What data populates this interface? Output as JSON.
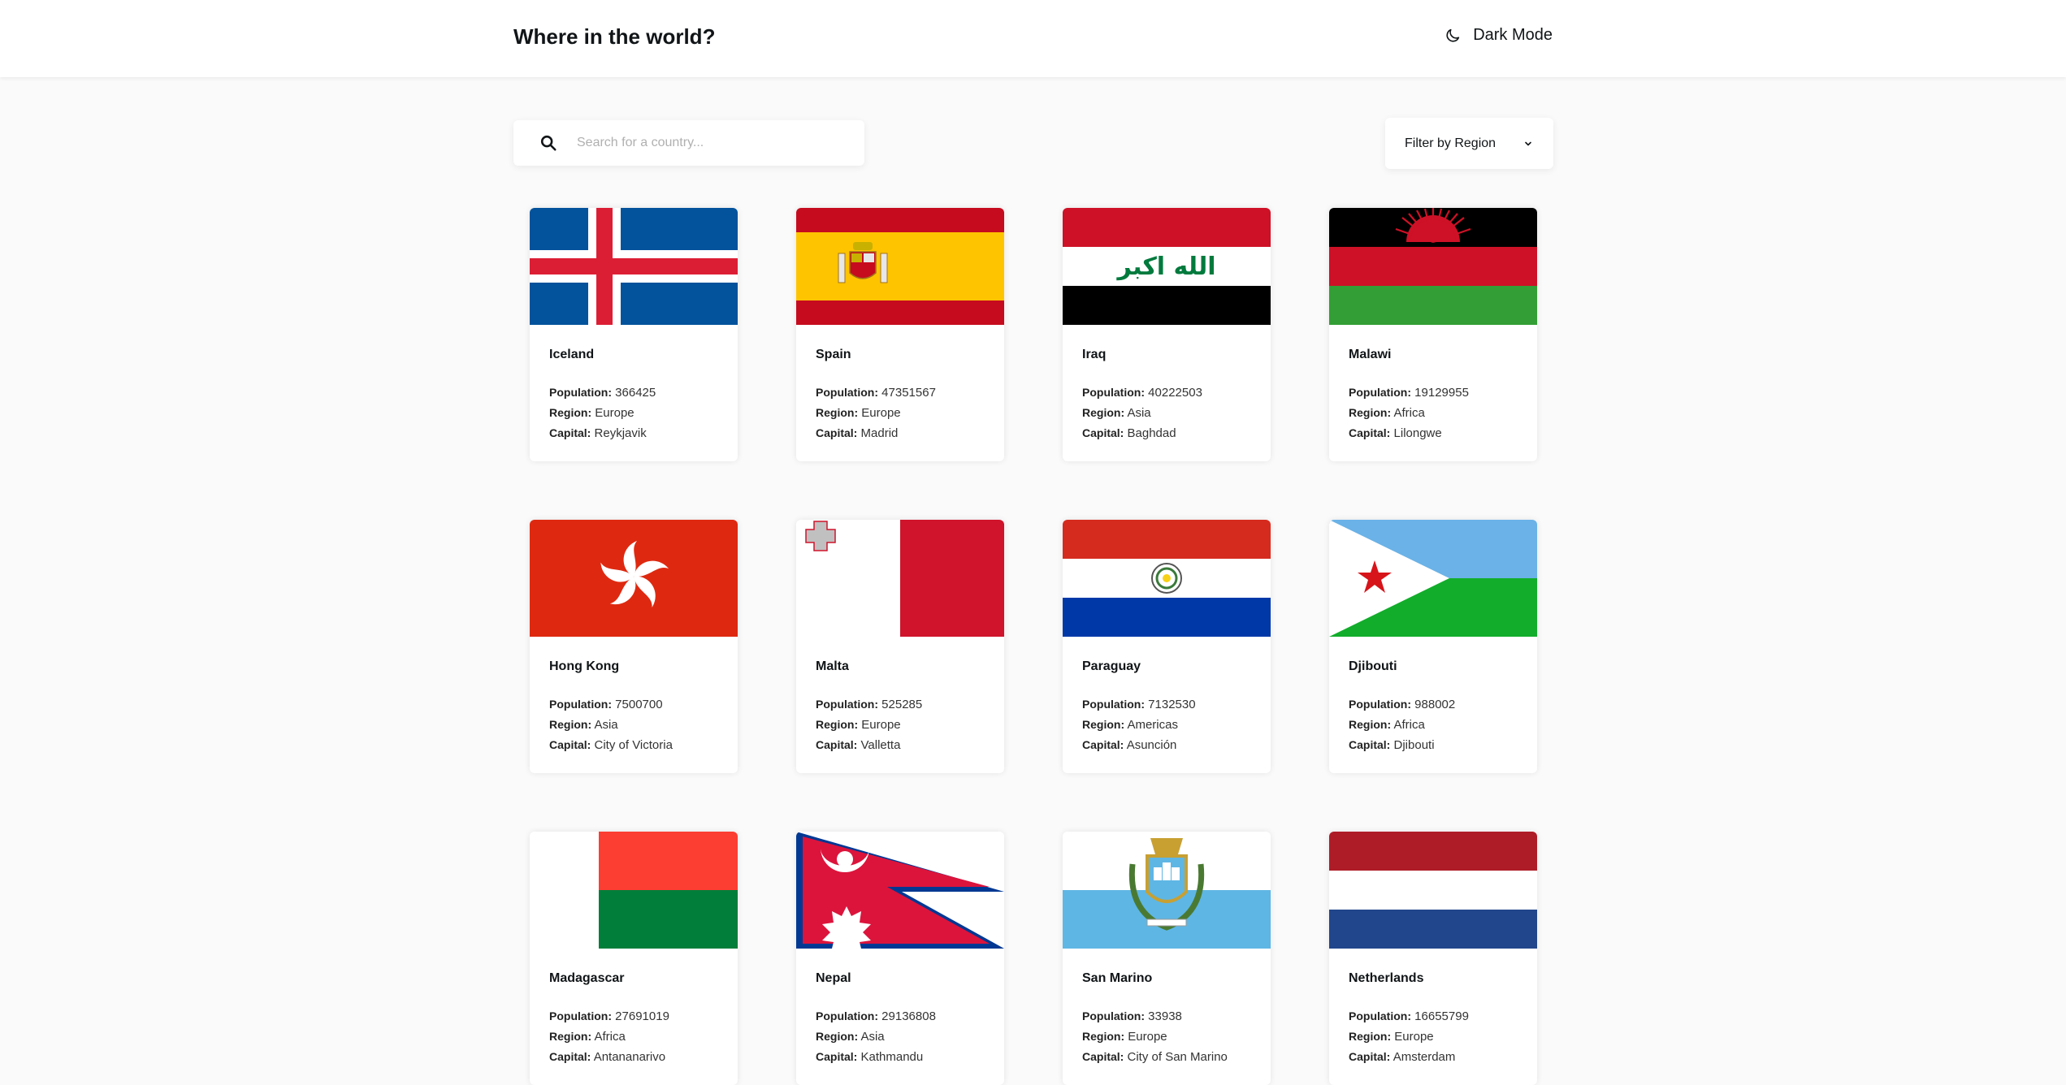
{
  "header": {
    "title": "Where in the world?",
    "dark_mode_label": "Dark Mode"
  },
  "search": {
    "placeholder": "Search for a country..."
  },
  "filter": {
    "label": "Filter by Region"
  },
  "labels": {
    "population": "Population:",
    "region": "Region:",
    "capital": "Capital:"
  },
  "countries": [
    {
      "name": "Iceland",
      "population": "366425",
      "region": "Europe",
      "capital": "Reykjavik"
    },
    {
      "name": "Spain",
      "population": "47351567",
      "region": "Europe",
      "capital": "Madrid"
    },
    {
      "name": "Iraq",
      "population": "40222503",
      "region": "Asia",
      "capital": "Baghdad"
    },
    {
      "name": "Malawi",
      "population": "19129955",
      "region": "Africa",
      "capital": "Lilongwe"
    },
    {
      "name": "Hong Kong",
      "population": "7500700",
      "region": "Asia",
      "capital": "City of Victoria"
    },
    {
      "name": "Malta",
      "population": "525285",
      "region": "Europe",
      "capital": "Valletta"
    },
    {
      "name": "Paraguay",
      "population": "7132530",
      "region": "Americas",
      "capital": "Asunción"
    },
    {
      "name": "Djibouti",
      "population": "988002",
      "region": "Africa",
      "capital": "Djibouti"
    },
    {
      "name": "Madagascar",
      "population": "27691019",
      "region": "Africa",
      "capital": "Antananarivo"
    },
    {
      "name": "Nepal",
      "population": "29136808",
      "region": "Asia",
      "capital": "Kathmandu"
    },
    {
      "name": "San Marino",
      "population": "33938",
      "region": "Europe",
      "capital": "City of San Marino"
    },
    {
      "name": "Netherlands",
      "population": "16655799",
      "region": "Europe",
      "capital": "Amsterdam"
    }
  ],
  "flag_arabic_text": "الله اكبر",
  "icons": {
    "dark_mode": "moon-icon",
    "search": "search-icon",
    "filter": "chevron-down-icon"
  }
}
